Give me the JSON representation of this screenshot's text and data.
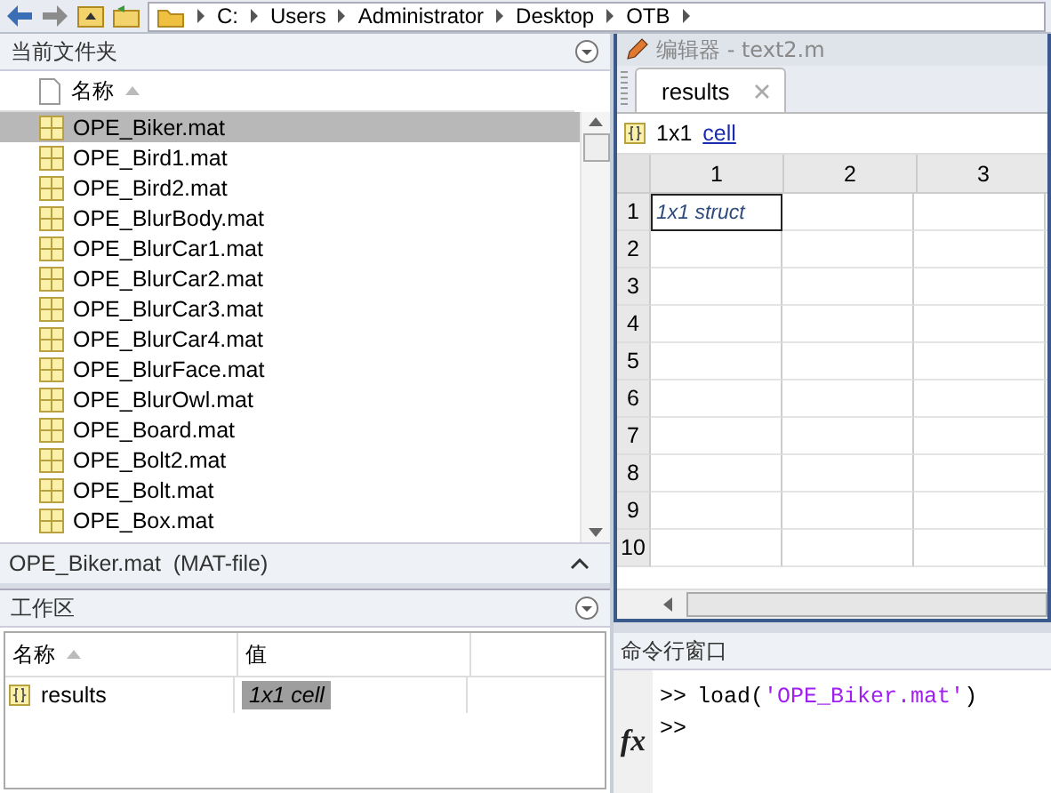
{
  "toolbar": {
    "path": [
      "C:",
      "Users",
      "Administrator",
      "Desktop",
      "OTB"
    ]
  },
  "current_folder": {
    "title": "当前文件夹",
    "column": {
      "label": "名称",
      "sorted": true
    },
    "files": [
      {
        "name": "OPE_Biker.mat",
        "selected": true
      },
      {
        "name": "OPE_Bird1.mat",
        "selected": false
      },
      {
        "name": "OPE_Bird2.mat",
        "selected": false
      },
      {
        "name": "OPE_BlurBody.mat",
        "selected": false
      },
      {
        "name": "OPE_BlurCar1.mat",
        "selected": false
      },
      {
        "name": "OPE_BlurCar2.mat",
        "selected": false
      },
      {
        "name": "OPE_BlurCar3.mat",
        "selected": false
      },
      {
        "name": "OPE_BlurCar4.mat",
        "selected": false
      },
      {
        "name": "OPE_BlurFace.mat",
        "selected": false
      },
      {
        "name": "OPE_BlurOwl.mat",
        "selected": false
      },
      {
        "name": "OPE_Board.mat",
        "selected": false
      },
      {
        "name": "OPE_Bolt2.mat",
        "selected": false
      },
      {
        "name": "OPE_Bolt.mat",
        "selected": false
      },
      {
        "name": "OPE_Box.mat",
        "selected": false
      }
    ],
    "details": "OPE_Biker.mat  (MAT-file)"
  },
  "workspace": {
    "title": "工作区",
    "columns": [
      {
        "label": "名称",
        "sorted": true
      },
      {
        "label": "值",
        "sorted": false
      }
    ],
    "variables": [
      {
        "name": "results",
        "value": "1x1 cell",
        "selected": true
      }
    ]
  },
  "editor": {
    "title": "编辑器 - text2.m",
    "tabs": [
      {
        "label": "results",
        "selected": true
      }
    ],
    "size": "1x1",
    "class_link": "cell",
    "columns": [
      "1",
      "2",
      "3"
    ],
    "rows": [
      {
        "label": "1",
        "cells": [
          {
            "text": "1x1 struct",
            "selected": true
          }
        ]
      },
      {
        "label": "2"
      },
      {
        "label": "3"
      },
      {
        "label": "4"
      },
      {
        "label": "5"
      },
      {
        "label": "6"
      },
      {
        "label": "7"
      },
      {
        "label": "8"
      },
      {
        "label": "9"
      },
      {
        "label": "10"
      }
    ]
  },
  "command_window": {
    "title": "命令行窗口",
    "prompt_icon": "fx",
    "lines": [
      {
        "prompt": ">>",
        "parts": [
          {
            "kind": "code",
            "text": "load("
          },
          {
            "kind": "string",
            "text": "'OPE_Biker.mat'"
          },
          {
            "kind": "code",
            "text": ")"
          }
        ]
      },
      {
        "prompt": ">>"
      }
    ]
  }
}
